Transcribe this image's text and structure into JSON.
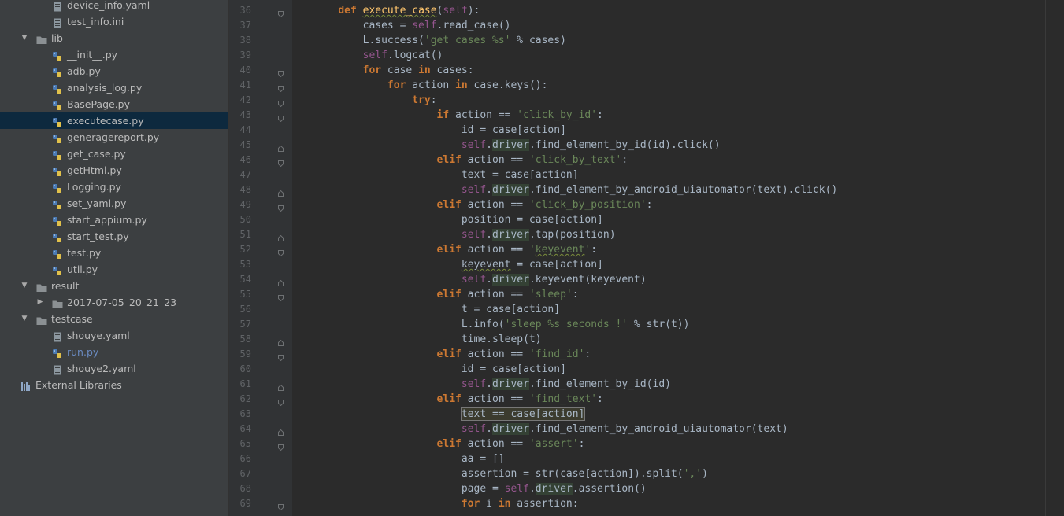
{
  "project_tree": {
    "items": [
      {
        "label": "device_info.yaml",
        "type": "yaml",
        "indent": 3
      },
      {
        "label": "test_info.ini",
        "type": "ini",
        "indent": 3
      },
      {
        "label": "lib",
        "type": "folder",
        "indent": 1,
        "expanded": true
      },
      {
        "label": "__init__.py",
        "type": "py",
        "indent": 3
      },
      {
        "label": "adb.py",
        "type": "py",
        "indent": 3
      },
      {
        "label": "analysis_log.py",
        "type": "py",
        "indent": 3
      },
      {
        "label": "BasePage.py",
        "type": "py",
        "indent": 3
      },
      {
        "label": "executecase.py",
        "type": "py",
        "indent": 3,
        "selected": true
      },
      {
        "label": "generagereport.py",
        "type": "py",
        "indent": 3
      },
      {
        "label": "get_case.py",
        "type": "py",
        "indent": 3
      },
      {
        "label": "getHtml.py",
        "type": "py",
        "indent": 3
      },
      {
        "label": "Logging.py",
        "type": "py",
        "indent": 3
      },
      {
        "label": "set_yaml.py",
        "type": "py",
        "indent": 3
      },
      {
        "label": "start_appium.py",
        "type": "py",
        "indent": 3
      },
      {
        "label": "start_test.py",
        "type": "py",
        "indent": 3
      },
      {
        "label": "test.py",
        "type": "py",
        "indent": 3
      },
      {
        "label": "util.py",
        "type": "py",
        "indent": 3
      },
      {
        "label": "result",
        "type": "folder",
        "indent": 1,
        "expanded": true
      },
      {
        "label": "2017-07-05_20_21_23",
        "type": "folder",
        "indent": 2,
        "expanded": false
      },
      {
        "label": "testcase",
        "type": "folder",
        "indent": 1,
        "expanded": true
      },
      {
        "label": "shouye.yaml",
        "type": "yaml",
        "indent": 3
      },
      {
        "label": "run.py",
        "type": "py",
        "indent": 2,
        "blue": true
      },
      {
        "label": "shouye2.yaml",
        "type": "yaml",
        "indent": 2
      },
      {
        "label": "External Libraries",
        "type": "lib",
        "indent": 0
      }
    ]
  },
  "editor": {
    "lines": [
      {
        "n": "36",
        "fold": "start",
        "html": "    <span class='k'>def</span> <span class='fn sq'>execute_case</span>(<span class='self'>self</span>):"
      },
      {
        "n": "37",
        "fold": "",
        "html": "        cases = <span class='self'>self</span>.read_case()"
      },
      {
        "n": "38",
        "fold": "",
        "html": "        L.success(<span class='s'>'get cases %s'</span> % cases)"
      },
      {
        "n": "39",
        "fold": "",
        "html": "        <span class='self'>self</span>.logcat()"
      },
      {
        "n": "40",
        "fold": "start",
        "html": "        <span class='k'>for</span> case <span class='k'>in</span> cases:"
      },
      {
        "n": "41",
        "fold": "start",
        "html": "            <span class='k'>for</span> action <span class='k'>in</span> case.keys():"
      },
      {
        "n": "42",
        "fold": "start",
        "html": "                <span class='k'>try</span>:"
      },
      {
        "n": "43",
        "fold": "start",
        "html": "                    <span class='k'>if</span> action == <span class='s'>'click_by_id'</span>:"
      },
      {
        "n": "44",
        "fold": "",
        "html": "                        id = case[action]"
      },
      {
        "n": "45",
        "fold": "end",
        "html": "                        <span class='self'>self</span>.<span class='attr'>driver</span>.find_element_by_id(id).click()"
      },
      {
        "n": "46",
        "fold": "start",
        "html": "                    <span class='k'>elif</span> action == <span class='s'>'click_by_text'</span>:"
      },
      {
        "n": "47",
        "fold": "",
        "html": "                        text = case[action]"
      },
      {
        "n": "48",
        "fold": "end",
        "html": "                        <span class='self'>self</span>.<span class='attr'>driver</span>.find_element_by_android_uiautomator(text).click()"
      },
      {
        "n": "49",
        "fold": "start",
        "html": "                    <span class='k'>elif</span> action == <span class='s'>'click_by_position'</span>:"
      },
      {
        "n": "50",
        "fold": "",
        "html": "                        position = case[action]"
      },
      {
        "n": "51",
        "fold": "end",
        "html": "                        <span class='self'>self</span>.<span class='attr'>driver</span>.tap(position)"
      },
      {
        "n": "52",
        "fold": "start",
        "html": "                    <span class='k'>elif</span> action == <span class='s'>'<span class=\"sq\">keyevent</span>'</span>:"
      },
      {
        "n": "53",
        "fold": "",
        "html": "                        <span class='sq'>keyevent</span> = case[action]"
      },
      {
        "n": "54",
        "fold": "end",
        "html": "                        <span class='self'>self</span>.<span class='attr'>driver</span>.keyevent(keyevent)"
      },
      {
        "n": "55",
        "fold": "start",
        "html": "                    <span class='k'>elif</span> action == <span class='s'>'sleep'</span>:"
      },
      {
        "n": "56",
        "fold": "",
        "html": "                        t = case[action]"
      },
      {
        "n": "57",
        "fold": "",
        "html": "                        L.info(<span class='s'>'sleep %s seconds !'</span> % str(t))"
      },
      {
        "n": "58",
        "fold": "end",
        "html": "                        time.sleep(t)"
      },
      {
        "n": "59",
        "fold": "start",
        "html": "                    <span class='k'>elif</span> action == <span class='s'>'find_id'</span>:"
      },
      {
        "n": "60",
        "fold": "",
        "html": "                        id = case[action]"
      },
      {
        "n": "61",
        "fold": "end",
        "html": "                        <span class='self'>self</span>.<span class='attr'>driver</span>.find_element_by_id(id)"
      },
      {
        "n": "62",
        "fold": "start",
        "html": "                    <span class='k'>elif</span> action == <span class='s'>'find_text'</span>:"
      },
      {
        "n": "63",
        "fold": "",
        "html": "                        <span class='hl'>text == case[action]</span>"
      },
      {
        "n": "64",
        "fold": "end",
        "html": "                        <span class='self'>self</span>.<span class='attr'>driver</span>.find_element_by_android_uiautomator(text)"
      },
      {
        "n": "65",
        "fold": "start",
        "html": "                    <span class='k'>elif</span> action == <span class='s'>'assert'</span>:"
      },
      {
        "n": "66",
        "fold": "",
        "html": "                        aa = []"
      },
      {
        "n": "67",
        "fold": "",
        "html": "                        assertion = str(case[action]).split(<span class='s'>','</span>)"
      },
      {
        "n": "68",
        "fold": "",
        "html": "                        page = <span class='self'>self</span>.<span class='attr'>driver</span>.assertion()"
      },
      {
        "n": "69",
        "fold": "start",
        "html": "                        <span class='k'>for</span> i <span class='k'>in</span> assertion:"
      }
    ]
  }
}
